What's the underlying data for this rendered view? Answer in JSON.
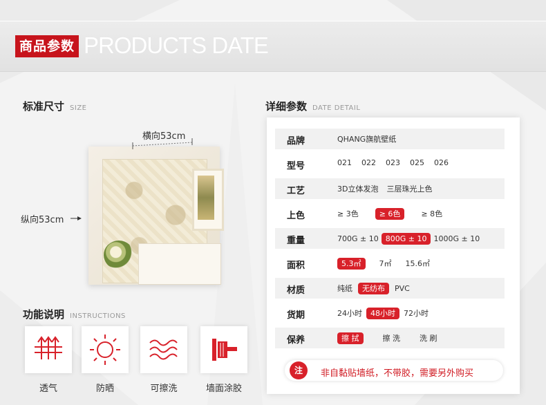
{
  "header": {
    "tag": "商品参数",
    "tag_en": "PRODUCTS DATE"
  },
  "size_section": {
    "title": "标准尺寸",
    "title_en": "SIZE",
    "horizontal": "横向53cm",
    "vertical": "纵向53cm"
  },
  "detail_section": {
    "title": "详细参数",
    "title_en": "DATE DETAIL",
    "rows": [
      {
        "label": "品牌",
        "values": [
          {
            "text": "QHANG旗航壁纸",
            "highlight": false
          }
        ]
      },
      {
        "label": "型号",
        "values": [
          {
            "text": "021",
            "highlight": false
          },
          {
            "text": "022",
            "highlight": false
          },
          {
            "text": "023",
            "highlight": false
          },
          {
            "text": "025",
            "highlight": false
          },
          {
            "text": "026",
            "highlight": false
          }
        ]
      },
      {
        "label": "工艺",
        "values": [
          {
            "text": "3D立体发泡",
            "highlight": false
          },
          {
            "text": "三层珠光上色",
            "highlight": false
          }
        ]
      },
      {
        "label": "上色",
        "values": [
          {
            "text": "≥ 3色",
            "highlight": false
          },
          {
            "text": "≥ 6色",
            "highlight": true
          },
          {
            "text": "≥ 8色",
            "highlight": false
          }
        ]
      },
      {
        "label": "重量",
        "values": [
          {
            "text": "700G ± 10",
            "highlight": false
          },
          {
            "text": "800G ± 10",
            "highlight": true
          },
          {
            "text": "1000G ± 10",
            "highlight": false
          }
        ]
      },
      {
        "label": "面积",
        "values": [
          {
            "text": "5.3㎡",
            "highlight": true
          },
          {
            "text": "7㎡",
            "highlight": false
          },
          {
            "text": "15.6㎡",
            "highlight": false
          }
        ]
      },
      {
        "label": "材质",
        "values": [
          {
            "text": "纯纸",
            "highlight": false
          },
          {
            "text": "无纺布",
            "highlight": true
          },
          {
            "text": "PVC",
            "highlight": false
          }
        ]
      },
      {
        "label": "货期",
        "values": [
          {
            "text": "24小时",
            "highlight": false
          },
          {
            "text": "48小时",
            "highlight": true
          },
          {
            "text": "72小时",
            "highlight": false
          }
        ]
      },
      {
        "label": "保养",
        "values": [
          {
            "text": "擦 拭",
            "highlight": true
          },
          {
            "text": "擦 洗",
            "highlight": false
          },
          {
            "text": "洗 刷",
            "highlight": false
          }
        ]
      }
    ],
    "note_icon": "注",
    "note": "非自黏贴墙纸，不带胶，需要另外购买"
  },
  "function_section": {
    "title": "功能说明",
    "title_en": "INSTRUCTIONS",
    "items": [
      {
        "label": "透气",
        "icon": "breathable-icon"
      },
      {
        "label": "防晒",
        "icon": "sun-icon"
      },
      {
        "label": "可擦洗",
        "icon": "washable-icon"
      },
      {
        "label": "墙面涂胶",
        "icon": "glue-brush-icon"
      }
    ]
  },
  "colors": {
    "accent": "#d8212a",
    "tag_red": "#c7141c",
    "background": "#f3f3f3"
  }
}
